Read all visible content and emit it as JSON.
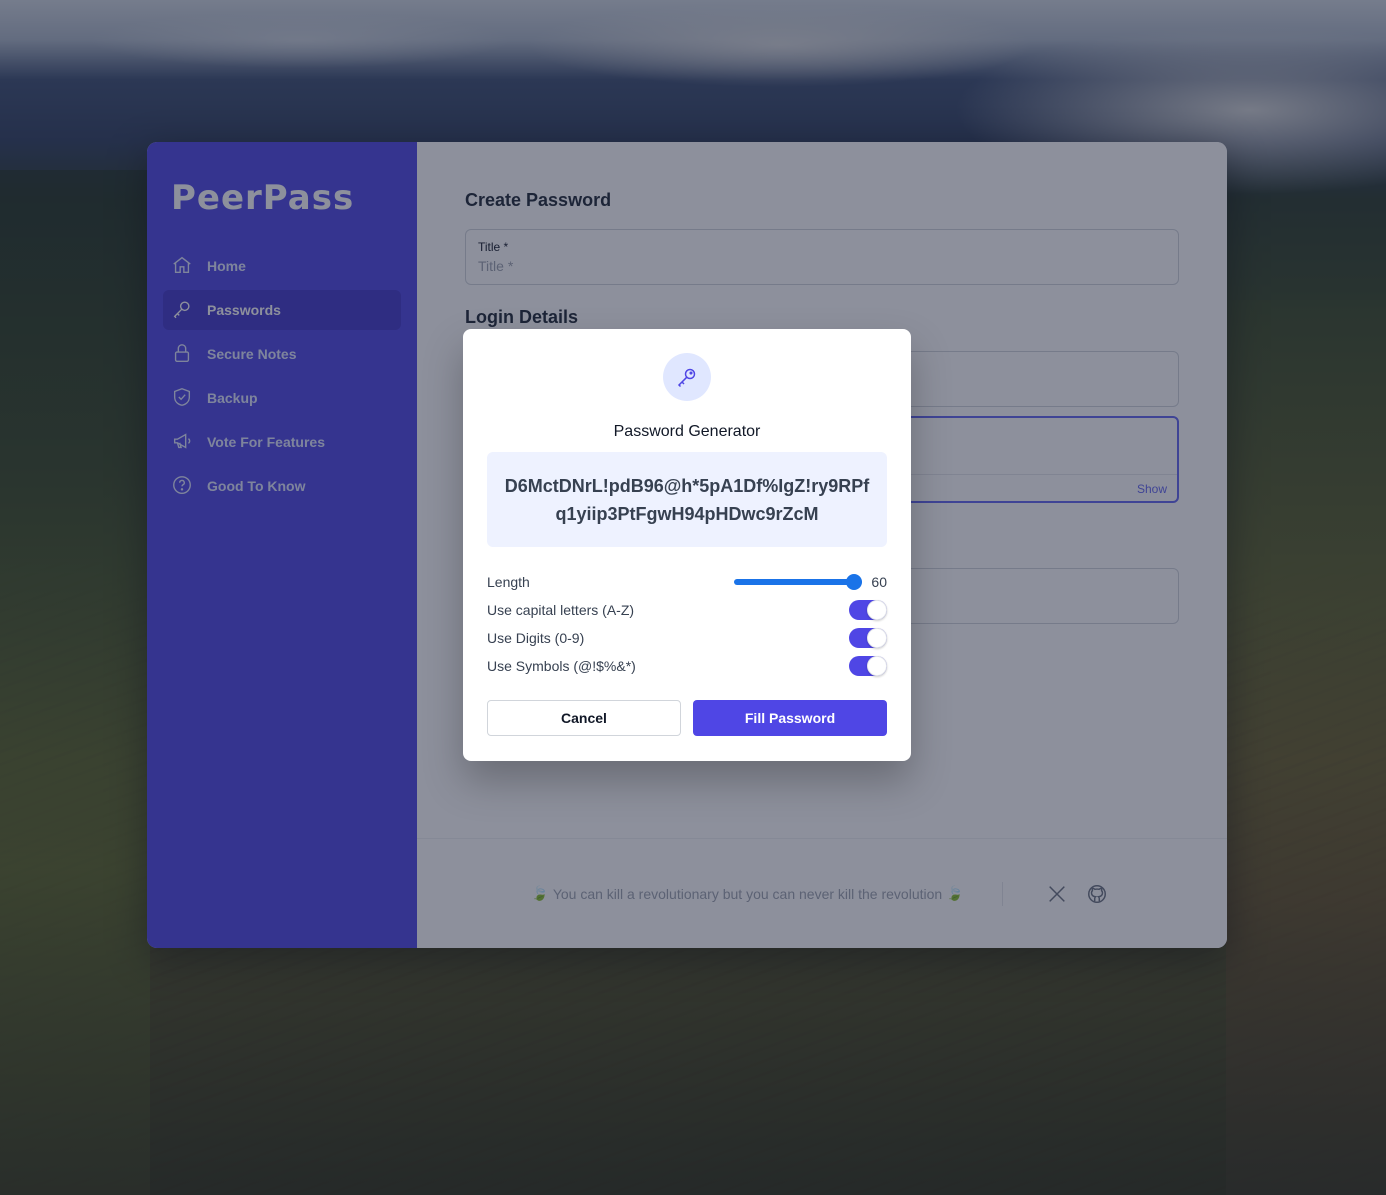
{
  "app": {
    "brand": "PeerPass"
  },
  "sidebar": {
    "items": [
      {
        "label": "Home",
        "icon": "home-icon"
      },
      {
        "label": "Passwords",
        "icon": "key-icon",
        "active": true
      },
      {
        "label": "Secure Notes",
        "icon": "lock-icon"
      },
      {
        "label": "Backup",
        "icon": "shield-check-icon"
      },
      {
        "label": "Vote For Features",
        "icon": "megaphone-icon"
      },
      {
        "label": "Good To Know",
        "icon": "question-circle-icon"
      }
    ]
  },
  "main": {
    "title": "Create Password",
    "title_field": {
      "label": "Title *",
      "placeholder": "Title *"
    },
    "login_section": "Login Details",
    "show_label": "Show"
  },
  "footer": {
    "quote": "You can kill a revolutionary but you can never kill the revolution",
    "leaf": "🍃",
    "social": [
      "x-icon",
      "github-icon"
    ]
  },
  "modal": {
    "icon": "key-icon",
    "title": "Password Generator",
    "password": "D6MctDNrL!pdB96@h*5pA1Df%IgZ!ry9RPfq1yiip3PtFgwH94pHDwc9rZcM",
    "length_label": "Length",
    "length_value": "60",
    "length_fraction": 1.0,
    "options": [
      {
        "label": "Use capital letters (A-Z)",
        "enabled": true
      },
      {
        "label": "Use Digits (0-9)",
        "enabled": true
      },
      {
        "label": "Use Symbols (@!$%&*)",
        "enabled": true
      }
    ],
    "cancel_label": "Cancel",
    "fill_label": "Fill Password"
  },
  "colors": {
    "accent": "#4f46e5",
    "sidebar_bg": "#4f46e5",
    "slider": "#1a73e8"
  }
}
